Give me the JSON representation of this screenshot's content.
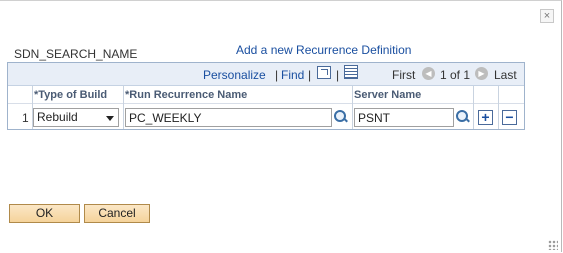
{
  "dialog": {
    "close_label": "×",
    "component_name": "SDN_SEARCH_NAME",
    "add_link": "Add a new Recurrence Definition"
  },
  "grid_nav": {
    "personalize": "Personalize",
    "separator": "|",
    "find": "Find",
    "first": "First",
    "range": "1 of 1",
    "last": "Last"
  },
  "columns": [
    "*Type of Build",
    "*Run Recurrence Name",
    "Server Name"
  ],
  "row": {
    "num": "1",
    "type_of_build": "Rebuild",
    "run_recurrence_name": "PC_WEEKLY",
    "server_name": "PSNT"
  },
  "row_actions": {
    "add": "+",
    "delete": "−"
  },
  "buttons": {
    "ok": "OK",
    "cancel": "Cancel"
  },
  "colors": {
    "link": "#1a4fa0",
    "grid_header_bg": "#e8eef7",
    "button_bg": "#f5d39b"
  }
}
